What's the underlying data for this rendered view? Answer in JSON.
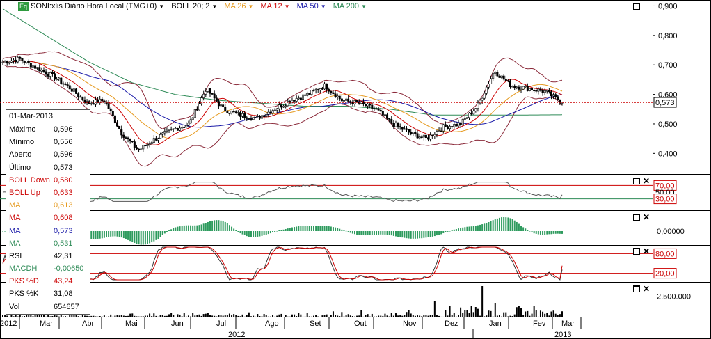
{
  "legend": {
    "badge": "Eq",
    "symbol": "SONI:xlis Diário Hora Local (TMG+0)",
    "items": [
      {
        "label": "BOLL 20; 2",
        "color": "#000000"
      },
      {
        "label": "MA 26",
        "color": "#e69a1f"
      },
      {
        "label": "MA 12",
        "color": "#cc0000"
      },
      {
        "label": "MA 50",
        "color": "#1a1aa8"
      },
      {
        "label": "MA 200",
        "color": "#2e8b57"
      }
    ]
  },
  "info_panel": {
    "date": "01-Mar-2013",
    "rows": [
      {
        "label": "Máximo",
        "value": "0,596",
        "color": "#000000"
      },
      {
        "label": "Mínimo",
        "value": "0,556",
        "color": "#000000"
      },
      {
        "label": "Aberto",
        "value": "0,596",
        "color": "#000000"
      },
      {
        "label": "Último",
        "value": "0,573",
        "color": "#000000"
      },
      {
        "label": "BOLL Down",
        "value": "0,580",
        "color": "#cc0000"
      },
      {
        "label": "BOLL Up",
        "value": "0,633",
        "color": "#cc0000"
      },
      {
        "label": "MA",
        "value": "0,613",
        "color": "#e69a1f"
      },
      {
        "label": "MA",
        "value": "0,608",
        "color": "#cc0000"
      },
      {
        "label": "MA",
        "value": "0,573",
        "color": "#1a1aa8"
      },
      {
        "label": "MA",
        "value": "0,531",
        "color": "#2e8b57"
      },
      {
        "label": "RSI",
        "value": "42,31",
        "color": "#000000"
      },
      {
        "label": "MACDH",
        "value": "-0,00650",
        "color": "#2e8b57"
      },
      {
        "label": "PKS %D",
        "value": "43,24",
        "color": "#cc0000"
      },
      {
        "label": "PKS %K",
        "value": "31,08",
        "color": "#000000"
      },
      {
        "label": "Vol",
        "value": "654657",
        "color": "#000000"
      }
    ]
  },
  "price_axis": {
    "ticks": [
      "0,900",
      "0,800",
      "0,700",
      "0,600",
      "0,500",
      "0,400"
    ],
    "last_price_label": "0,573"
  },
  "rsi_axis": {
    "ticks": [
      "70,00",
      "50,00",
      "30,00"
    ]
  },
  "macd_axis": {
    "ticks": [
      "0,00000"
    ]
  },
  "stoch_axis": {
    "ticks": [
      "80,00",
      "20,00"
    ]
  },
  "volume_axis": {
    "ticks": [
      "2.500.000"
    ]
  },
  "time_axis": {
    "months": [
      "2012",
      "Mar",
      "Abr",
      "Mai",
      "Jun",
      "Jul",
      "Ago",
      "Set",
      "Out",
      "Nov",
      "Dez",
      "Jan",
      "Fev",
      "Mar"
    ],
    "years": [
      "2012",
      "2013"
    ]
  },
  "colors": {
    "up_candle": "#ffffff",
    "down_candle": "#000000",
    "bollinger": "#8b2a3a",
    "ma26": "#e69a1f",
    "ma12": "#cc0000",
    "ma50": "#1a1aa8",
    "ma200": "#2e8b57",
    "macd_hist": "#2e9b5e",
    "last_price_line": "#cc0000"
  },
  "chart_data": {
    "type": "line",
    "title": "SONI:xlis Diário Hora Local (TMG+0)",
    "x": [
      "Fev 2012",
      "Mar 2012",
      "Abr 2012",
      "Mai 2012",
      "Jun 2012",
      "Jul 2012",
      "Ago 2012",
      "Set 2012",
      "Out 2012",
      "Nov 2012",
      "Dez 2012",
      "Jan 2013",
      "Fev 2013",
      "Mar 2013"
    ],
    "series": [
      {
        "name": "SONI",
        "values": [
          0.71,
          0.67,
          0.6,
          0.45,
          0.47,
          0.52,
          0.53,
          0.61,
          0.56,
          0.47,
          0.49,
          0.63,
          0.62,
          0.573
        ]
      },
      {
        "name": "MA 26",
        "values": [
          0.7,
          0.69,
          0.64,
          0.53,
          0.49,
          0.51,
          0.53,
          0.57,
          0.56,
          0.5,
          0.48,
          0.57,
          0.61,
          0.613
        ]
      },
      {
        "name": "MA 12",
        "values": [
          0.71,
          0.68,
          0.62,
          0.5,
          0.47,
          0.52,
          0.54,
          0.59,
          0.56,
          0.48,
          0.48,
          0.6,
          0.62,
          0.608
        ]
      },
      {
        "name": "MA 50",
        "values": [
          0.67,
          0.68,
          0.66,
          0.58,
          0.52,
          0.49,
          0.51,
          0.55,
          0.56,
          0.53,
          0.5,
          0.52,
          0.55,
          0.573
        ]
      },
      {
        "name": "MA 200",
        "values": [
          0.89,
          0.8,
          0.71,
          0.64,
          0.6,
          0.58,
          0.57,
          0.56,
          0.56,
          0.55,
          0.53,
          0.53,
          0.53,
          0.531
        ]
      }
    ],
    "ylim": [
      0.33,
      0.92
    ],
    "last_value": 0.573,
    "panels": {
      "rsi": {
        "lines": [
          70,
          30
        ],
        "last": 42.31
      },
      "macd_hist": {
        "last": -0.0065
      },
      "stochastic": {
        "lines": [
          80,
          20
        ],
        "pks_d": 43.24,
        "pks_k": 31.08
      },
      "volume": {
        "last": 654657,
        "peak": 3700000
      }
    }
  }
}
